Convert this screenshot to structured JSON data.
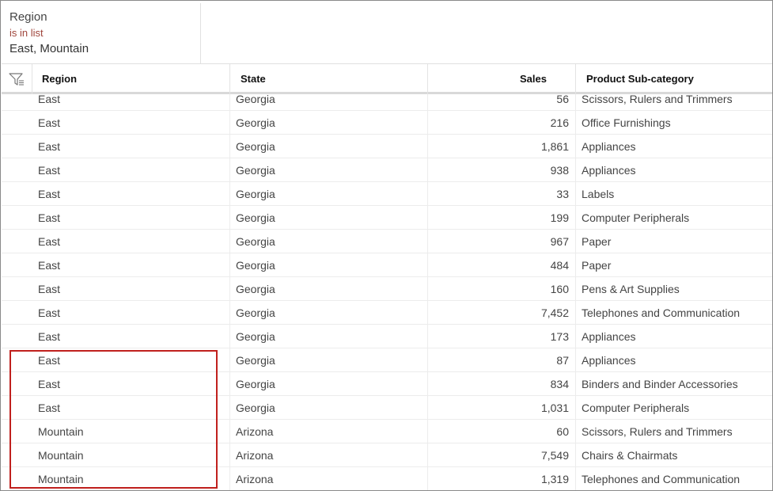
{
  "filter": {
    "field": "Region",
    "operator": "is in list",
    "values": "East, Mountain"
  },
  "table": {
    "columns": [
      "Region",
      "State",
      "Sales",
      "Product Sub-category"
    ],
    "rows": [
      [
        "East",
        "Georgia",
        "56",
        "Scissors, Rulers and Trimmers"
      ],
      [
        "East",
        "Georgia",
        "216",
        "Office Furnishings"
      ],
      [
        "East",
        "Georgia",
        "1,861",
        "Appliances"
      ],
      [
        "East",
        "Georgia",
        "938",
        "Appliances"
      ],
      [
        "East",
        "Georgia",
        "33",
        "Labels"
      ],
      [
        "East",
        "Georgia",
        "199",
        "Computer Peripherals"
      ],
      [
        "East",
        "Georgia",
        "967",
        "Paper"
      ],
      [
        "East",
        "Georgia",
        "484",
        "Paper"
      ],
      [
        "East",
        "Georgia",
        "160",
        "Pens & Art Supplies"
      ],
      [
        "East",
        "Georgia",
        "7,452",
        "Telephones and Communication"
      ],
      [
        "East",
        "Georgia",
        "173",
        "Appliances"
      ],
      [
        "East",
        "Georgia",
        "87",
        "Appliances"
      ],
      [
        "East",
        "Georgia",
        "834",
        "Binders and Binder Accessories"
      ],
      [
        "East",
        "Georgia",
        "1,031",
        "Computer Peripherals"
      ],
      [
        "Mountain",
        "Arizona",
        "60",
        "Scissors, Rulers and Trimmers"
      ],
      [
        "Mountain",
        "Arizona",
        "7,549",
        "Chairs & Chairmats"
      ],
      [
        "Mountain",
        "Arizona",
        "1,319",
        "Telephones and Communication"
      ]
    ]
  },
  "icons": {
    "column_filter": "funnel-icon"
  },
  "colors": {
    "filter_operator": "#a0463c",
    "highlight_border": "#c0201d"
  }
}
